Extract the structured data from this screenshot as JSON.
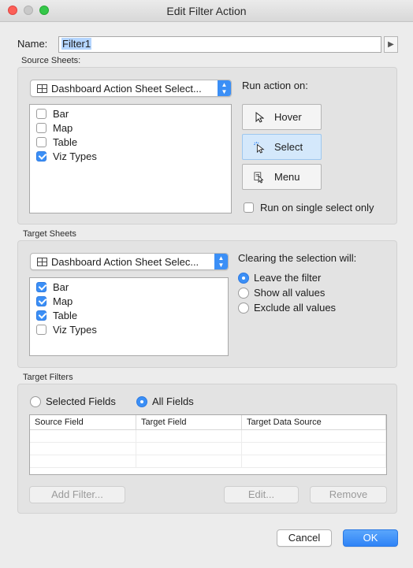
{
  "window": {
    "title": "Edit Filter Action"
  },
  "name": {
    "label": "Name:",
    "value": "Filter1"
  },
  "source_sheets": {
    "label": "Source Sheets:",
    "dropdown": "Dashboard Action Sheet Select...",
    "items": [
      {
        "label": "Bar",
        "checked": false
      },
      {
        "label": "Map",
        "checked": false
      },
      {
        "label": "Table",
        "checked": false
      },
      {
        "label": "Viz Types",
        "checked": true
      }
    ]
  },
  "run_action": {
    "label": "Run action on:",
    "buttons": [
      {
        "label": "Hover",
        "icon": "cursor-arrow-icon",
        "active": false
      },
      {
        "label": "Select",
        "icon": "cursor-click-icon",
        "active": true
      },
      {
        "label": "Menu",
        "icon": "cursor-menu-icon",
        "active": false
      }
    ],
    "single_select": {
      "label": "Run on single select only",
      "checked": false
    }
  },
  "target_sheets": {
    "label": "Target Sheets",
    "dropdown": "Dashboard Action Sheet Selec...",
    "items": [
      {
        "label": "Bar",
        "checked": true
      },
      {
        "label": "Map",
        "checked": true
      },
      {
        "label": "Table",
        "checked": true
      },
      {
        "label": "Viz Types",
        "checked": false
      }
    ]
  },
  "clearing": {
    "label": "Clearing the selection will:",
    "options": [
      {
        "label": "Leave the filter",
        "selected": true
      },
      {
        "label": "Show all values",
        "selected": false
      },
      {
        "label": "Exclude all values",
        "selected": false
      }
    ]
  },
  "target_filters": {
    "label": "Target Filters",
    "modes": [
      {
        "label": "Selected Fields",
        "selected": false
      },
      {
        "label": "All Fields",
        "selected": true
      }
    ],
    "columns": [
      "Source Field",
      "Target Field",
      "Target Data Source"
    ],
    "add_label": "Add Filter...",
    "edit_label": "Edit...",
    "remove_label": "Remove"
  },
  "footer": {
    "cancel_label": "Cancel",
    "ok_label": "OK"
  },
  "colors": {
    "accent": "#3b8ff6",
    "selected_button": "#d4e8fb"
  }
}
